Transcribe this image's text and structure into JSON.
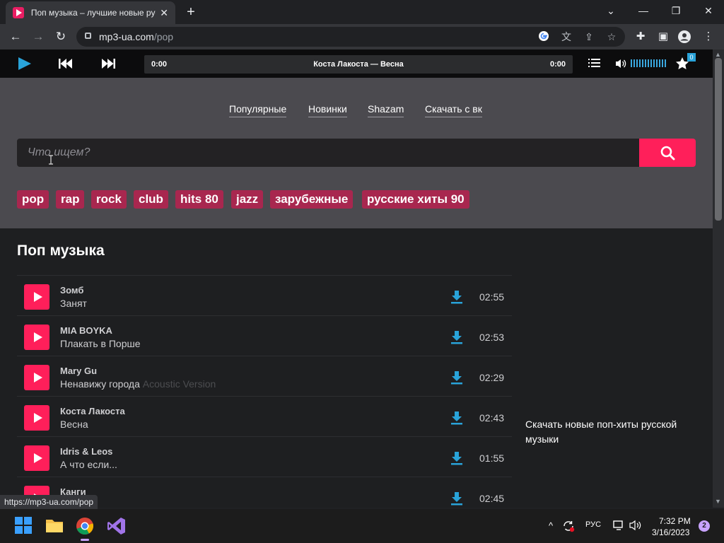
{
  "browser": {
    "tab_title": "Поп музыка – лучшие новые русские",
    "url_host": "mp3-ua.com",
    "url_path": "/pop",
    "status_url": "https://mp3-ua.com/pop"
  },
  "player": {
    "time_current": "0:00",
    "time_total": "0:00",
    "now_playing": "Коста Лакоста — Весна",
    "favorites_count": "0"
  },
  "nav": {
    "links": [
      "Популярные",
      "Новинки",
      "Shazam",
      "Скачать с вк"
    ]
  },
  "search": {
    "placeholder": "Что ищем?"
  },
  "tags": [
    "pop",
    "rap",
    "rock",
    "club",
    "hits 80",
    "jazz",
    "зарубежные",
    "русские хиты 90"
  ],
  "section": {
    "title": "Поп музыка"
  },
  "tracks": [
    {
      "artist": "Зомб",
      "title": "Занят",
      "extra": "",
      "duration": "02:55"
    },
    {
      "artist": "MIA BOYKA",
      "title": "Плакать в Порше",
      "extra": "",
      "duration": "02:53"
    },
    {
      "artist": "Mary Gu",
      "title": "Ненавижу города",
      "extra": "Acoustic Version",
      "duration": "02:29"
    },
    {
      "artist": "Коста Лакоста",
      "title": "Весна",
      "extra": "",
      "duration": "02:43"
    },
    {
      "artist": "Idris & Leos",
      "title": "А что если...",
      "extra": "",
      "duration": "01:55"
    },
    {
      "artist": "Канги",
      "title": "",
      "extra": "",
      "duration": "02:45"
    }
  ],
  "side": {
    "text": "Скачать новые поп-хиты русской музыки"
  },
  "taskbar": {
    "lang": "РУС",
    "time": "7:32 PM",
    "date": "3/16/2023",
    "notifications": "2"
  },
  "colors": {
    "accent": "#ff1f5a",
    "tag_bg": "#a8274f",
    "download_icon": "#29a3d9"
  }
}
